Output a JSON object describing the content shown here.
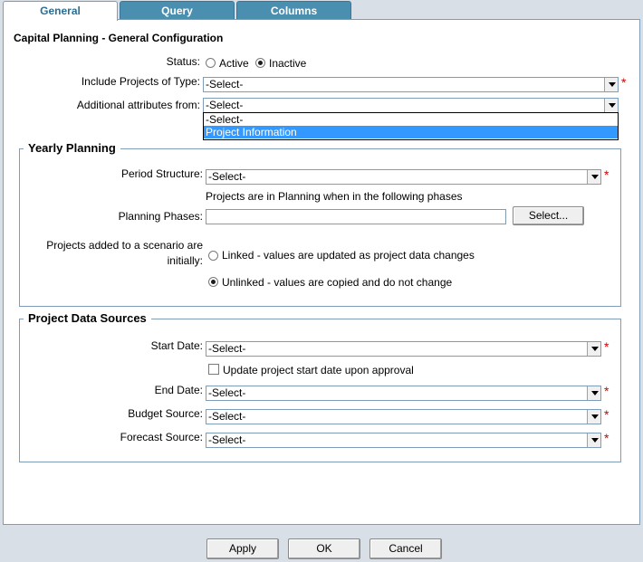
{
  "tabs": [
    {
      "label": "General",
      "active": true
    },
    {
      "label": "Query",
      "active": false
    },
    {
      "label": "Columns",
      "active": false
    }
  ],
  "page_title": "Capital Planning - General Configuration",
  "general": {
    "status_label": "Status:",
    "status_options": [
      "Active",
      "Inactive"
    ],
    "status_selected": "Inactive",
    "include_label": "Include Projects of Type:",
    "include_value": "-Select-",
    "additional_label": "Additional attributes from:",
    "additional_value": "-Select-",
    "additional_options": [
      "-Select-",
      "Project Information"
    ],
    "additional_highlighted": "Project Information"
  },
  "yearly_planning": {
    "legend": "Yearly Planning",
    "period_label": "Period Structure:",
    "period_value": "-Select-",
    "phases_note": "Projects are in Planning when in the following phases",
    "phases_label": "Planning Phases:",
    "phases_value": "",
    "select_button": "Select...",
    "scenario_label_line1": "Projects added to a scenario are",
    "scenario_label_line2": "initially:",
    "linked_label": "Linked - values are updated as project data changes",
    "unlinked_label": "Unlinked - values are copied and do not change",
    "scenario_selected": "Unlinked"
  },
  "data_sources": {
    "legend": "Project Data Sources",
    "start_label": "Start Date:",
    "start_value": "-Select-",
    "update_checkbox_label": "Update project start date upon approval",
    "update_checked": false,
    "end_label": "End Date:",
    "end_value": "-Select-",
    "budget_label": "Budget Source:",
    "budget_value": "-Select-",
    "forecast_label": "Forecast Source:",
    "forecast_value": "-Select-"
  },
  "required_marker": "*",
  "footer": {
    "apply": "Apply",
    "ok": "OK",
    "cancel": "Cancel"
  },
  "colors": {
    "tab_inactive": "#4a8fb0",
    "tab_active_text": "#2b6e94",
    "highlight": "#3399ff",
    "required": "#d00000",
    "background": "#d9dfe6"
  }
}
